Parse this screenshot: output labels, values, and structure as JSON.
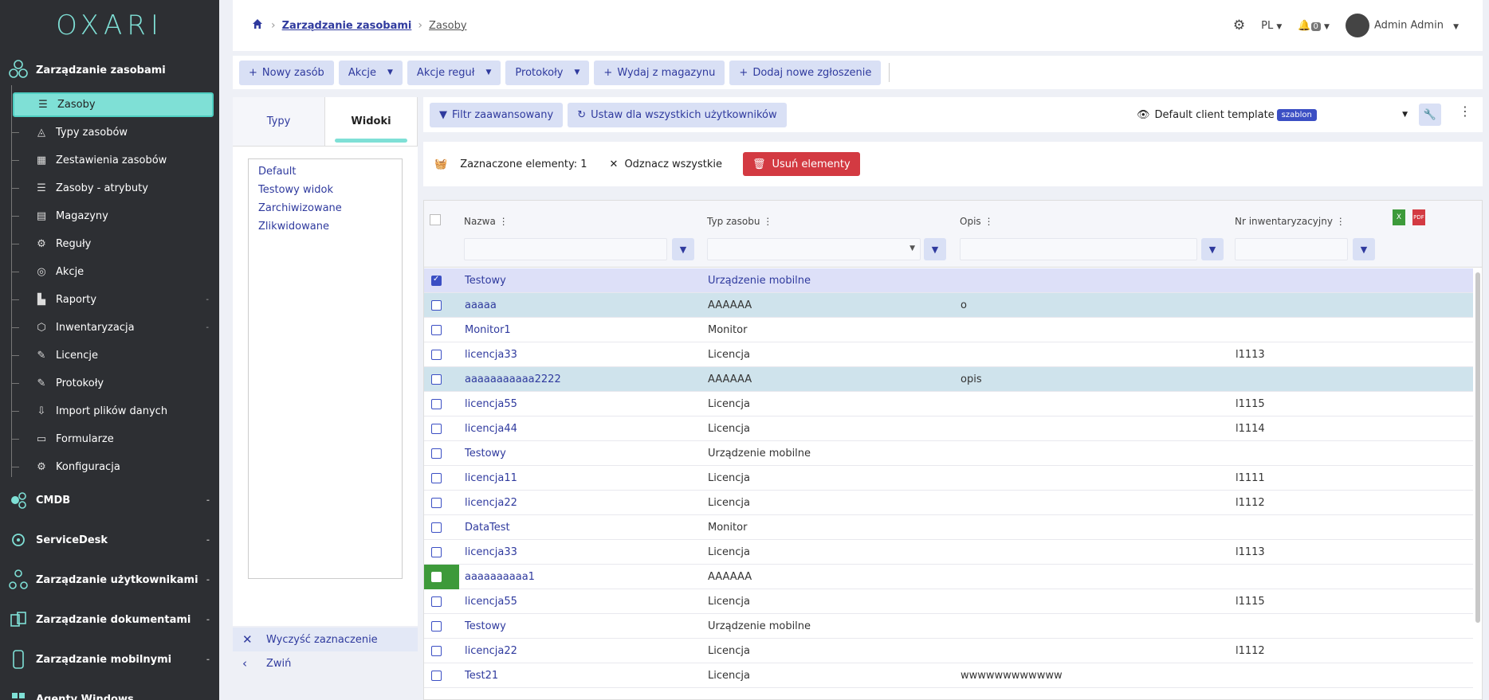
{
  "sidebar": {
    "logo": "OXARI",
    "section_assets": "Zarządzanie zasobami",
    "items": [
      {
        "label": "Zasoby",
        "icon": "list-icon"
      },
      {
        "label": "Typy zasobów",
        "icon": "shapes-icon"
      },
      {
        "label": "Zestawienia zasobów",
        "icon": "table-icon"
      },
      {
        "label": "Zasoby - atrybuty",
        "icon": "list-icon"
      },
      {
        "label": "Magazyny",
        "icon": "building-icon"
      },
      {
        "label": "Reguły",
        "icon": "rules-icon"
      },
      {
        "label": "Akcje",
        "icon": "target-icon"
      },
      {
        "label": "Raporty",
        "icon": "chart-icon"
      },
      {
        "label": "Inwentaryzacja",
        "icon": "box-icon"
      },
      {
        "label": "Licencje",
        "icon": "license-icon"
      },
      {
        "label": "Protokoły",
        "icon": "protocol-icon"
      },
      {
        "label": "Import plików danych",
        "icon": "import-icon"
      },
      {
        "label": "Formularze",
        "icon": "form-icon"
      },
      {
        "label": "Konfiguracja",
        "icon": "config-icon"
      }
    ],
    "sections": [
      {
        "label": "CMDB"
      },
      {
        "label": "ServiceDesk"
      },
      {
        "label": "Zarządzanie użytkownikami"
      },
      {
        "label": "Zarządzanie dokumentami"
      },
      {
        "label": "Zarządzanie mobilnymi"
      },
      {
        "label": "Agenty Windows"
      }
    ]
  },
  "header": {
    "breadcrumb_parent": "Zarządzanie zasobami",
    "breadcrumb_current": "Zasoby",
    "lang": "PL",
    "notif_count": "0",
    "user": "Admin Admin"
  },
  "actions": {
    "new_asset": "Nowy zasób",
    "actions": "Akcje",
    "rule_actions": "Akcje reguł",
    "protocols": "Protokoły",
    "issue_warehouse": "Wydaj z magazynu",
    "add_ticket": "Dodaj nowe zgłoszenie"
  },
  "left_panel": {
    "tab_types": "Typy",
    "tab_views": "Widoki",
    "views": [
      "Default",
      "Testowy widok",
      "Zarchiwizowane",
      "Zlikwidowane"
    ],
    "clear_selection": "Wyczyść zaznaczenie",
    "collapse": "Zwiń"
  },
  "filterbar": {
    "advanced_filter": "Filtr zaawansowany",
    "set_for_all": "Ustaw dla wszystkich użytkowników",
    "template_name": "Default client template",
    "template_badge": "szablon"
  },
  "selection": {
    "selected_label": "Zaznaczone elementy: 1",
    "unselect_all": "Odznacz wszystkie",
    "delete": "Usuń elementy"
  },
  "table": {
    "columns": [
      "Nazwa",
      "Typ zasobu",
      "Opis",
      "Nr inwentaryzacyjny"
    ],
    "rows": [
      {
        "name": "Testowy",
        "type": "Urządzenie mobilne",
        "desc": "",
        "inv": "",
        "state": "selected"
      },
      {
        "name": "aaaaa",
        "type": "AAAAAA",
        "desc": "o",
        "inv": "",
        "state": "highlight"
      },
      {
        "name": "Monitor1",
        "type": "Monitor",
        "desc": "",
        "inv": "",
        "state": ""
      },
      {
        "name": "licencja33",
        "type": "Licencja",
        "desc": "",
        "inv": "l1113",
        "state": ""
      },
      {
        "name": "aaaaaaaaaaa2222",
        "type": "AAAAAA",
        "desc": "opis",
        "inv": "",
        "state": "highlight"
      },
      {
        "name": "licencja55",
        "type": "Licencja",
        "desc": "",
        "inv": "l1115",
        "state": ""
      },
      {
        "name": "licencja44",
        "type": "Licencja",
        "desc": "",
        "inv": "l1114",
        "state": ""
      },
      {
        "name": "Testowy",
        "type": "Urządzenie mobilne",
        "desc": "",
        "inv": "",
        "state": ""
      },
      {
        "name": "licencja11",
        "type": "Licencja",
        "desc": "",
        "inv": "l1111",
        "state": ""
      },
      {
        "name": "licencja22",
        "type": "Licencja",
        "desc": "",
        "inv": "l1112",
        "state": ""
      },
      {
        "name": "DataTest",
        "type": "Monitor",
        "desc": "",
        "inv": "",
        "state": ""
      },
      {
        "name": "licencja33",
        "type": "Licencja",
        "desc": "",
        "inv": "l1113",
        "state": ""
      },
      {
        "name": "aaaaaaaaaa1",
        "type": "AAAAAA",
        "desc": "",
        "inv": "",
        "state": "green"
      },
      {
        "name": "licencja55",
        "type": "Licencja",
        "desc": "",
        "inv": "l1115",
        "state": ""
      },
      {
        "name": "Testowy",
        "type": "Urządzenie mobilne",
        "desc": "",
        "inv": "",
        "state": ""
      },
      {
        "name": "licencja22",
        "type": "Licencja",
        "desc": "",
        "inv": "l1112",
        "state": ""
      },
      {
        "name": "Test21",
        "type": "Licencja",
        "desc": "wwwwwwwwwwww",
        "inv": "",
        "state": ""
      }
    ]
  },
  "colors": {
    "accent": "#7fe0d6",
    "link": "#2f3a9e",
    "danger": "#d33a42",
    "sidebar_bg": "#2d2f33"
  }
}
